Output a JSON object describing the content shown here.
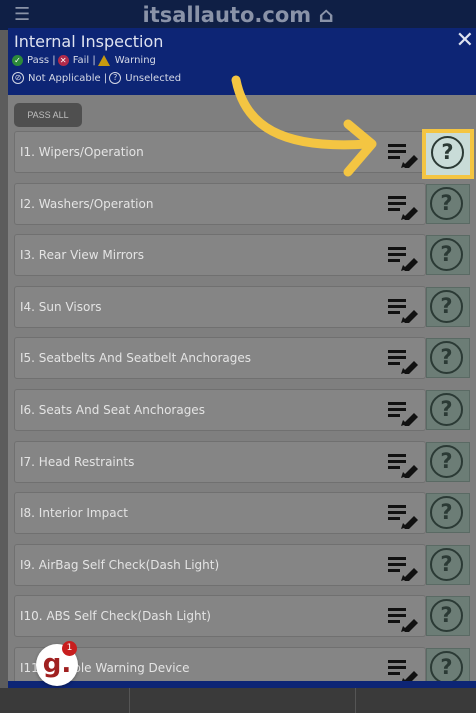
{
  "topbar": {
    "brand": "itsallauto.com"
  },
  "modal": {
    "title": "Internal Inspection",
    "legend": {
      "pass": "Pass |",
      "fail": "Fail |",
      "warning": "Warning",
      "na": "Not Applicable |",
      "unselected": "Unselected"
    },
    "pass_all_label": "PASS ALL",
    "items": [
      {
        "label": "I1. Wipers/Operation",
        "status": "?"
      },
      {
        "label": "I2. Washers/Operation",
        "status": "?"
      },
      {
        "label": "I3. Rear View Mirrors",
        "status": "?"
      },
      {
        "label": "I4. Sun Visors",
        "status": "?"
      },
      {
        "label": "I5. Seatbelts And Seatbelt Anchorages",
        "status": "?"
      },
      {
        "label": "I6. Seats And Seat Anchorages",
        "status": "?"
      },
      {
        "label": "I7. Head Restraints",
        "status": "?"
      },
      {
        "label": "I8. Interior Impact",
        "status": "?"
      },
      {
        "label": "I9. AirBag Self Check(Dash Light)",
        "status": "?"
      },
      {
        "label": "I10. ABS Self Check(Dash Light)",
        "status": "?"
      },
      {
        "label": "I11. Audible Warning Device",
        "status": "?"
      }
    ]
  },
  "badge": {
    "letter": "g.",
    "count": "1"
  },
  "colors": {
    "header": "#0d2575",
    "highlight": "#f4c542",
    "badge": "#c81e1e"
  }
}
